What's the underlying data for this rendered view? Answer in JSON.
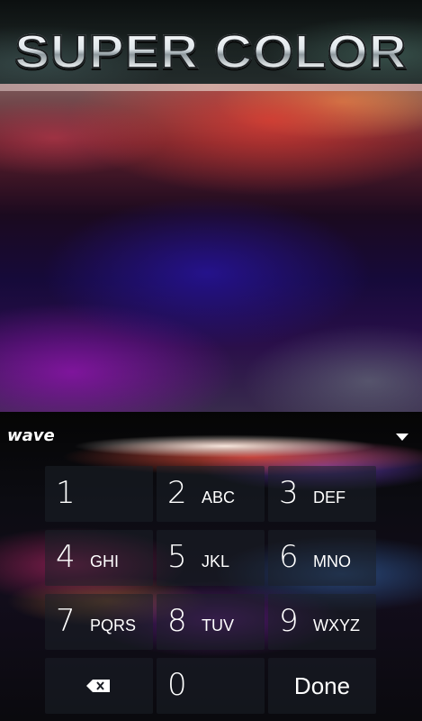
{
  "header": {
    "title": "SUPER COLOR"
  },
  "keyboard": {
    "brand": "wave",
    "collapse_icon": "chevron-down-icon",
    "keys": {
      "k1": {
        "num": "1",
        "letters": ""
      },
      "k2": {
        "num": "2",
        "letters": "ABC"
      },
      "k3": {
        "num": "3",
        "letters": "DEF"
      },
      "k4": {
        "num": "4",
        "letters": "GHI"
      },
      "k5": {
        "num": "5",
        "letters": "JKL"
      },
      "k6": {
        "num": "6",
        "letters": "MNO"
      },
      "k7": {
        "num": "7",
        "letters": "PQRS"
      },
      "k8": {
        "num": "8",
        "letters": "TUV"
      },
      "k9": {
        "num": "9",
        "letters": "WXYZ"
      },
      "k0": {
        "num": "0"
      },
      "backspace_icon": "backspace-icon",
      "done": "Done"
    }
  }
}
